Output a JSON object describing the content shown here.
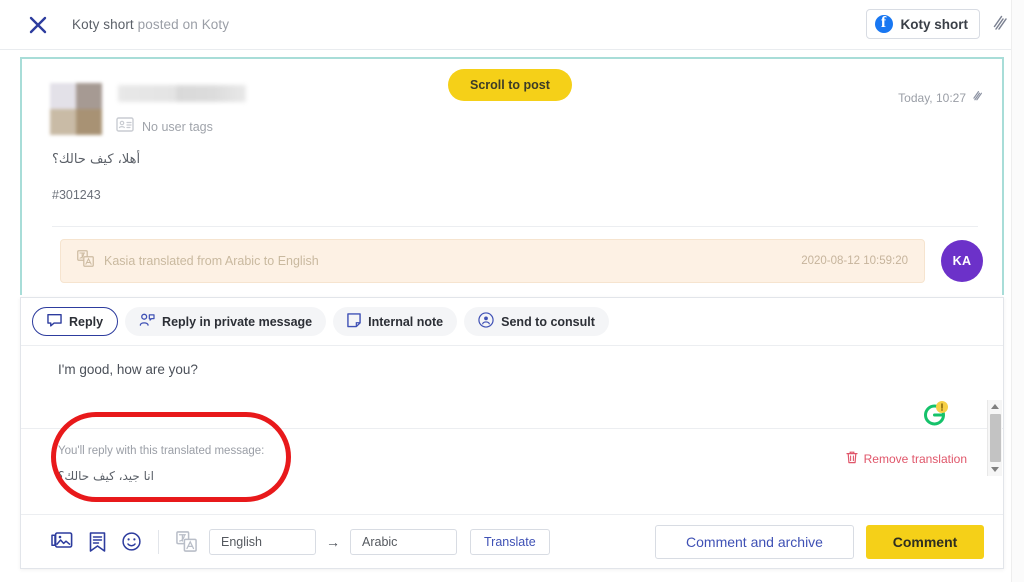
{
  "header": {
    "close_icon": "close-icon",
    "title_name": "Koty short",
    "title_rest": "posted on Koty",
    "channel_badge_label": "Koty short",
    "channel_icon": "facebook-icon",
    "link_icon": "slash-link-icon"
  },
  "post": {
    "avatar": "blurred-user-avatar",
    "name_blurred": "blurred-user-name",
    "tags_icon": "id-card-icon",
    "tags_label": "No user tags",
    "message": "أهلا، كيف حالك؟",
    "ticket_ref": "#301243",
    "scroll_button": "Scroll to post",
    "timestamp": "Today, 10:27",
    "timestamp_icon": "slash-link-icon",
    "translation": {
      "icon": "translate-icon",
      "text": "Kasia translated from Arabic to English",
      "time": "2020-08-12 10:59:20",
      "agent_initials": "KA",
      "agent_color": "#6c31c9"
    }
  },
  "reply": {
    "tabs": [
      {
        "label": "Reply",
        "icon": "comment-bubble-icon",
        "active": true
      },
      {
        "label": "Reply in private message",
        "icon": "private-message-icon",
        "active": false
      },
      {
        "label": "Internal note",
        "icon": "note-icon",
        "active": false
      },
      {
        "label": "Send to consult",
        "icon": "broadcast-icon",
        "active": false
      }
    ],
    "editor_text": "I'm good, how are you?",
    "grammar_icon": "grammarly-icon",
    "translated_note": "You'll reply with this translated message:",
    "translated_text": "انا جيد، كيف حالك؟",
    "remove_translation_label": "Remove translation",
    "remove_translation_icon": "trash-icon",
    "annotation": "red-highlight-ellipse"
  },
  "toolbar": {
    "icons": [
      {
        "name": "attach-image-icon"
      },
      {
        "name": "saved-replies-icon"
      },
      {
        "name": "emoji-icon"
      }
    ],
    "translate_icon": "translate-icon",
    "source_language": "English",
    "arrow": "→",
    "target_language": "Arabic",
    "translate_button": "Translate",
    "comment_archive_button": "Comment and archive",
    "comment_button": "Comment"
  },
  "colors": {
    "accent_yellow": "#f5d018",
    "accent_blue": "#3f51b5",
    "card_border_teal": "#a8ddd8",
    "translation_bg": "#fdf1e4",
    "annotation_red": "#e8191b",
    "remove_red": "#e0566a"
  }
}
